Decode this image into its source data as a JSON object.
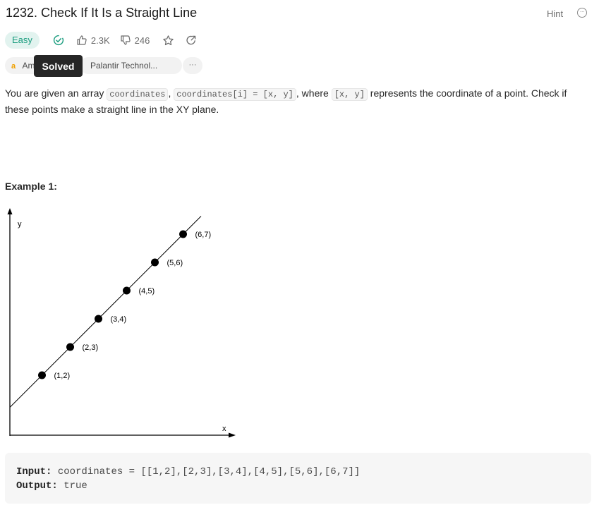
{
  "problem": {
    "title": "1232. Check If It Is a Straight Line",
    "hint_label": "Hint",
    "difficulty": "Easy",
    "likes": "2.3K",
    "dislikes": "246"
  },
  "tags": [
    {
      "label": "Am",
      "icon": "amazon-icon"
    },
    {
      "label": "Palantir Technol..."
    }
  ],
  "tooltip": "Solved",
  "tags_more": "···",
  "description": {
    "p1": "You are given an array ",
    "c1": "coordinates",
    "p2": ", ",
    "c2": "coordinates[i] = [x, y]",
    "p3": ", where ",
    "c3": "[x, y]",
    "p4": " represents the coordinate of a point. Check if these points make a straight line in the XY plane."
  },
  "example": {
    "title": "Example 1:",
    "input_label": "Input:",
    "input_value": "coordinates = [[1,2],[2,3],[3,4],[4,5],[5,6],[6,7]]",
    "output_label": "Output:",
    "output_value": "true"
  },
  "chart_data": {
    "type": "scatter",
    "xlabel": "x",
    "ylabel": "y",
    "points": [
      {
        "x": 1,
        "y": 2,
        "label": "(1,2)"
      },
      {
        "x": 2,
        "y": 3,
        "label": "(2,3)"
      },
      {
        "x": 3,
        "y": 4,
        "label": "(3,4)"
      },
      {
        "x": 4,
        "y": 5,
        "label": "(4,5)"
      },
      {
        "x": 5,
        "y": 6,
        "label": "(5,6)"
      },
      {
        "x": 6,
        "y": 7,
        "label": "(6,7)"
      }
    ],
    "line": {
      "slope": 1,
      "intercept": 1
    }
  },
  "colors": {
    "easy_text": "#1a9c7e",
    "easy_bg": "#e2f3ef",
    "solved_check": "#1a9c7e",
    "amazon": "#f0a000"
  }
}
